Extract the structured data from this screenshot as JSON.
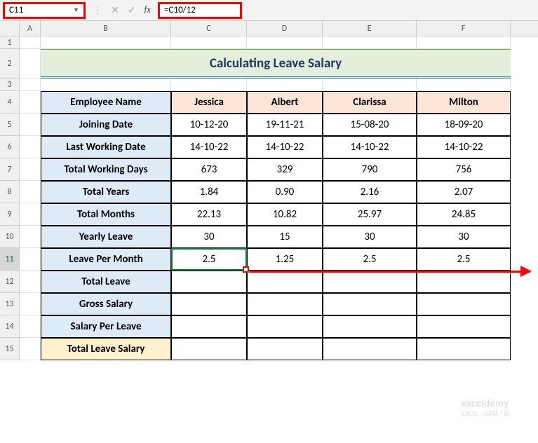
{
  "formula_bar": {
    "name_box": "C11",
    "formula": "=C10/12",
    "fx_label": "fx"
  },
  "columns": [
    "A",
    "B",
    "C",
    "D",
    "E",
    "F"
  ],
  "rows": [
    "1",
    "2",
    "3",
    "4",
    "5",
    "6",
    "7",
    "8",
    "9",
    "10",
    "11",
    "12",
    "13",
    "14",
    "15"
  ],
  "title": "Calculating Leave Salary",
  "table": {
    "header_row": [
      "Employee Name",
      "Jessica",
      "Albert",
      "Clarissa",
      "Milton"
    ],
    "rows": [
      {
        "label": "Joining Date",
        "vals": [
          "10-12-20",
          "19-11-21",
          "15-08-20",
          "18-09-20"
        ]
      },
      {
        "label": "Last Working Date",
        "vals": [
          "14-10-22",
          "14-10-22",
          "14-10-22",
          "14-10-22"
        ]
      },
      {
        "label": "Total Working Days",
        "vals": [
          "673",
          "329",
          "790",
          "756"
        ]
      },
      {
        "label": "Total Years",
        "vals": [
          "1.84",
          "0.90",
          "2.16",
          "2.07"
        ]
      },
      {
        "label": "Total Months",
        "vals": [
          "22.13",
          "10.82",
          "25.97",
          "24.85"
        ]
      },
      {
        "label": "Yearly Leave",
        "vals": [
          "30",
          "15",
          "30",
          "30"
        ]
      },
      {
        "label": "Leave Per Month",
        "vals": [
          "2.5",
          "1.25",
          "2.5",
          "2.5"
        ]
      },
      {
        "label": "Total Leave",
        "vals": [
          "",
          "",
          "",
          ""
        ]
      },
      {
        "label": "Gross Salary",
        "vals": [
          "",
          "",
          "",
          ""
        ]
      },
      {
        "label": "Salary Per Leave",
        "vals": [
          "",
          "",
          "",
          ""
        ]
      },
      {
        "label": "Total Leave Salary",
        "vals": [
          "",
          "",
          "",
          ""
        ]
      }
    ]
  },
  "watermark": {
    "main": "exceldemy",
    "sub": "EXCEL · DATA · BI"
  }
}
